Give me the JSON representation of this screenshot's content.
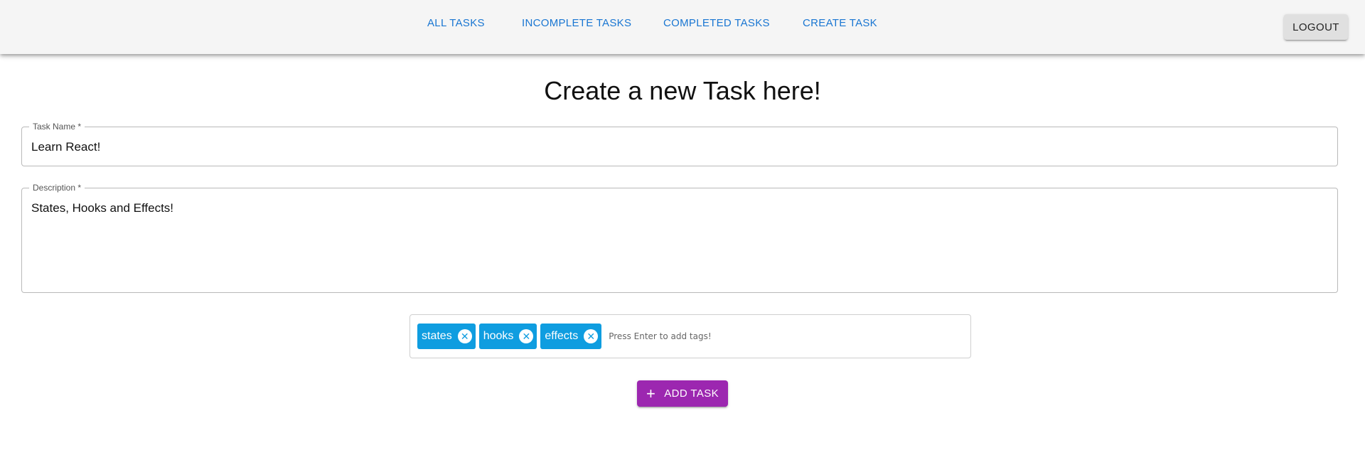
{
  "nav": {
    "links": [
      "All Tasks",
      "Incomplete Tasks",
      "Completed Tasks",
      "Create Task"
    ],
    "logout_label": "Logout",
    "link_color": "#1976d2"
  },
  "page": {
    "title": "Create a new Task here!"
  },
  "form": {
    "task_name": {
      "label": "Task Name *",
      "value": "Learn React!"
    },
    "description": {
      "label": "Description *",
      "value": "States, Hooks and Effects!"
    },
    "tags": {
      "items": [
        "states",
        "hooks",
        "effects"
      ],
      "remove_icon": "close-circle-icon",
      "placeholder": "Press Enter to add tags!",
      "chip_color": "#0f9de0"
    },
    "submit": {
      "label": "Add Task",
      "icon": "plus-icon",
      "color": "#9c27b0"
    }
  }
}
